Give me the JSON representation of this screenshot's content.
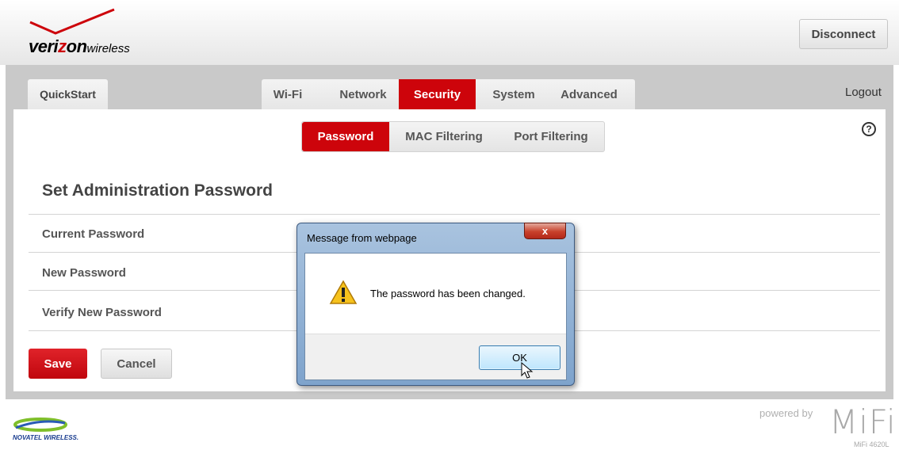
{
  "header": {
    "brand_prefix": "veri",
    "brand_z": "z",
    "brand_on": "on",
    "brand_suffix": "wireless",
    "disconnect_label": "Disconnect"
  },
  "nav": {
    "quickstart_label": "QuickStart",
    "tabs": [
      {
        "label": "Wi-Fi",
        "active": false
      },
      {
        "label": "Network",
        "active": false
      },
      {
        "label": "Security",
        "active": true
      },
      {
        "label": "System",
        "active": false
      },
      {
        "label": "Advanced",
        "active": false
      }
    ],
    "logout_label": "Logout"
  },
  "subtabs": [
    {
      "label": "Password",
      "active": true
    },
    {
      "label": "MAC Filtering",
      "active": false
    },
    {
      "label": "Port Filtering",
      "active": false
    }
  ],
  "help_icon": "question-circle-icon",
  "form": {
    "title": "Set Administration Password",
    "fields": [
      {
        "label": "Current Password"
      },
      {
        "label": "New Password"
      },
      {
        "label": "Verify New Password"
      }
    ],
    "save_label": "Save",
    "cancel_label": "Cancel"
  },
  "footer": {
    "vendor_logo_text": "NOVATEL WIRELESS.",
    "powered_by": "powered by",
    "product": "MiFi",
    "model": "MiFi 4620L"
  },
  "dialog": {
    "title": "Message from webpage",
    "close_glyph": "x",
    "message": "The password has been changed.",
    "ok_label": "OK",
    "icon": "warning-icon"
  },
  "colors": {
    "accent_red": "#cd040b",
    "frame_gray": "#c9c9c9",
    "dialog_chrome": "#8fb0d4"
  }
}
